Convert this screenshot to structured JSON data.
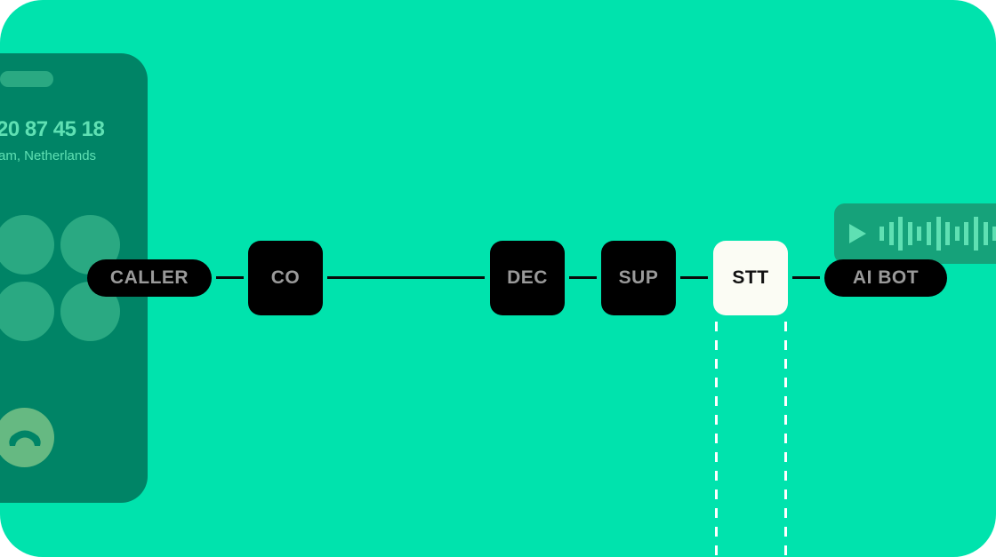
{
  "phone": {
    "number": "20 87 45 18",
    "location": "am, Netherlands",
    "keypad_icon": "keypad-button",
    "hangup_icon": "phone-hangup-icon"
  },
  "pipeline": {
    "caller_label": "CALLER",
    "nodes": [
      {
        "label": "CO",
        "active": false
      },
      {
        "label": "DEC",
        "active": false
      },
      {
        "label": "SUP",
        "active": false
      },
      {
        "label": "STT",
        "active": true
      }
    ],
    "bot_label": "AI BOT"
  },
  "audio_message": {
    "play_icon": "play-icon",
    "waveform_levels": [
      0.42,
      0.68,
      1.0,
      0.68,
      0.42,
      0.68,
      1.0,
      0.68,
      0.42,
      0.68,
      1.0,
      0.68,
      0.42
    ]
  },
  "colors": {
    "background": "#00e3ad",
    "phone": "#008466",
    "node": "#000000",
    "node_active": "#fbfcf4",
    "accent_light": "#5fe0b3"
  }
}
